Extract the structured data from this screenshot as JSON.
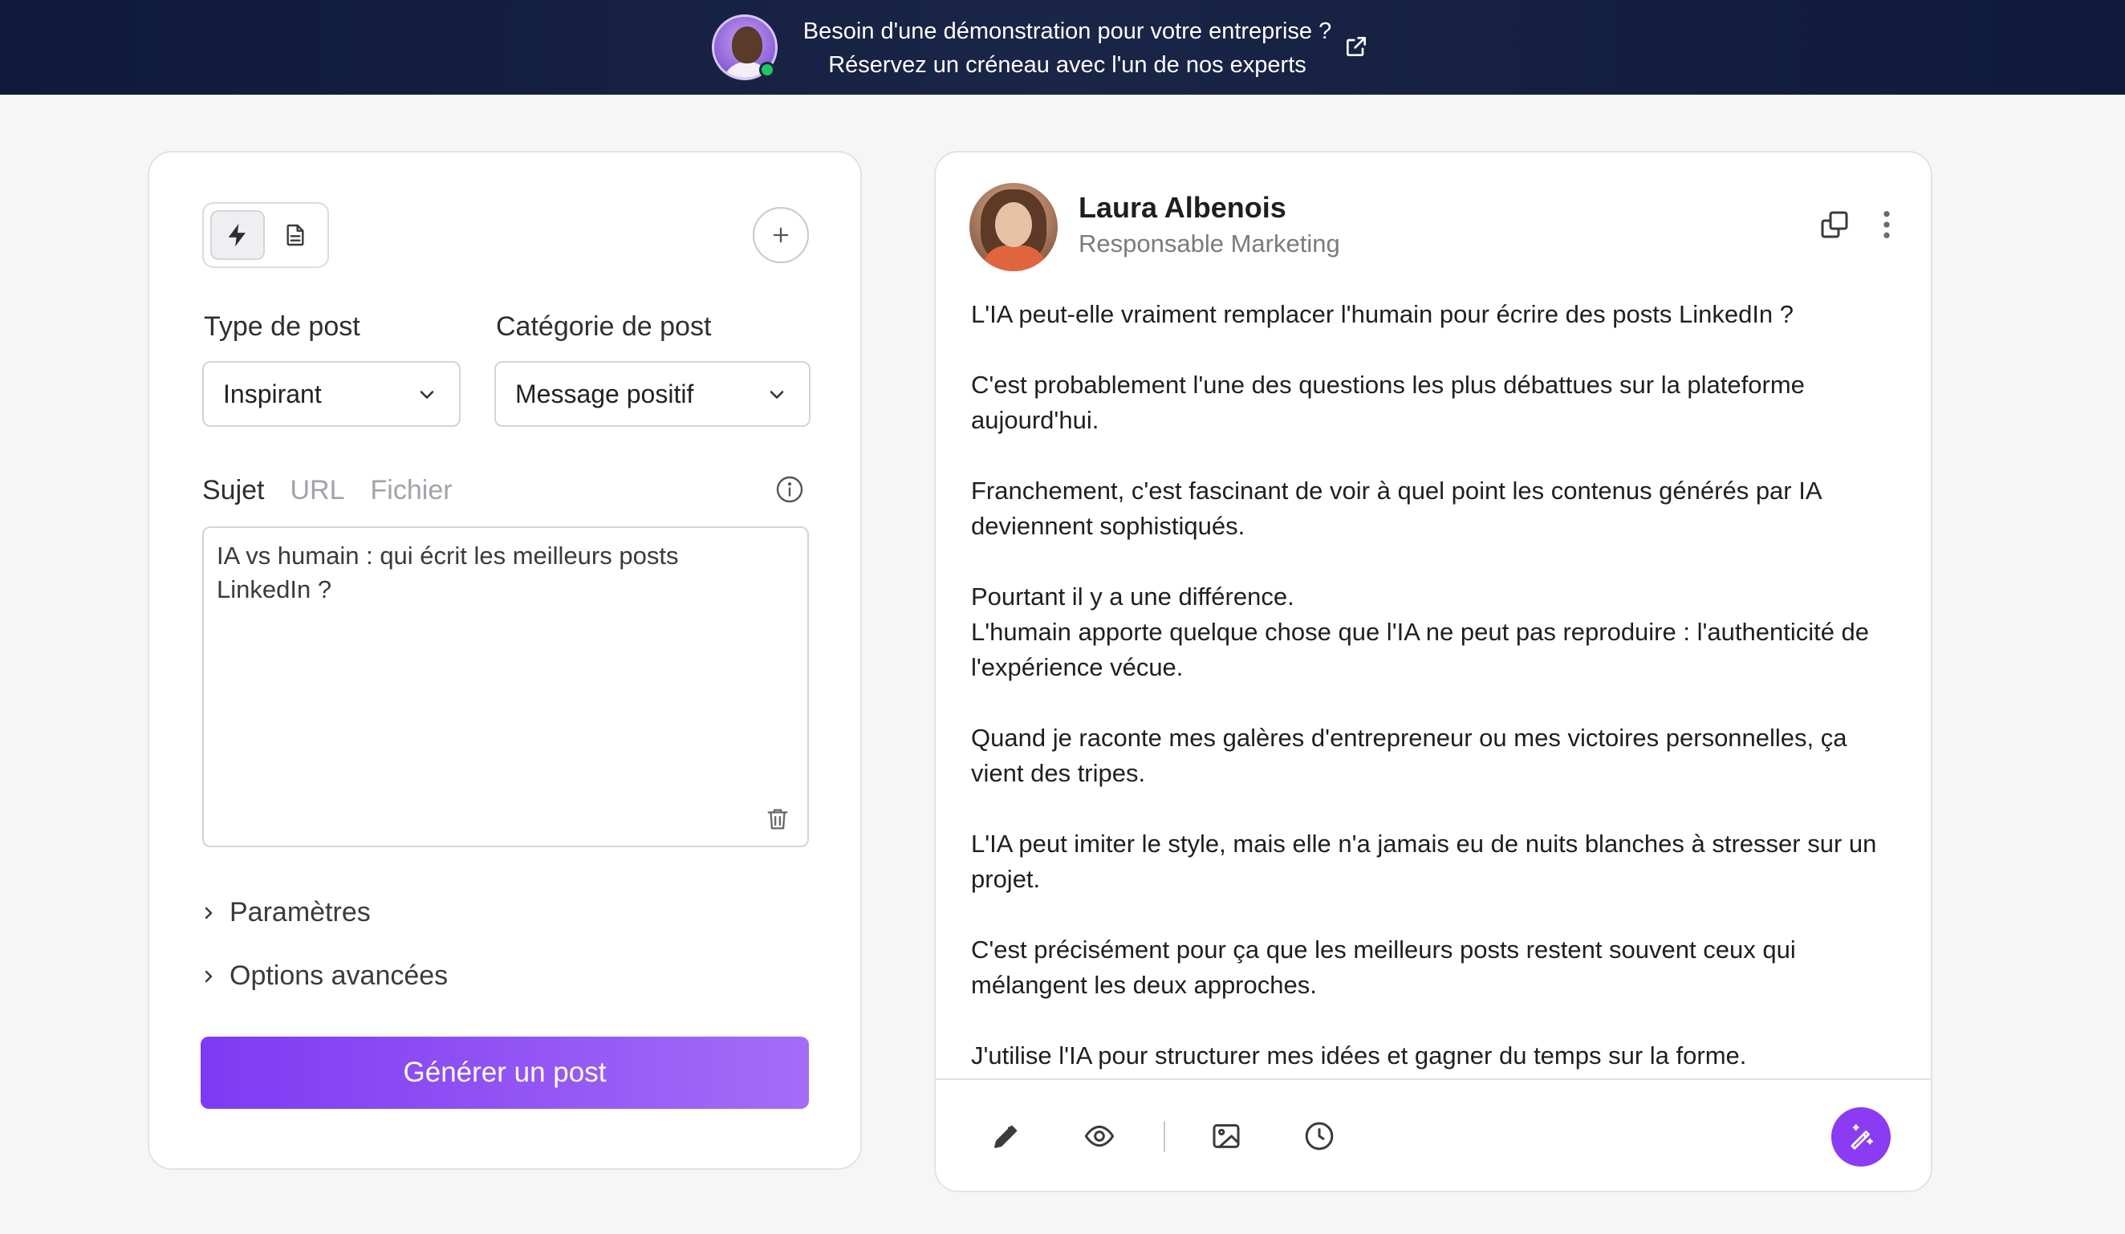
{
  "banner": {
    "line1": "Besoin d'une démonstration pour votre entreprise ?",
    "line2": "Réservez un créneau avec l'un de nos experts",
    "icon": "external-link-icon"
  },
  "left_panel": {
    "mode_icons": [
      "lightning-icon",
      "document-icon"
    ],
    "add_icon": "plus-icon",
    "post_type_label": "Type de post",
    "post_type_value": "Inspirant",
    "post_category_label": "Catégorie de post",
    "post_category_value": "Message positif",
    "tabs": [
      "Sujet",
      "URL",
      "Fichier"
    ],
    "active_tab": "Sujet",
    "subject_text": "IA vs humain : qui écrit les meilleurs posts LinkedIn ?",
    "parametres_label": "Paramètres",
    "options_label": "Options avancées",
    "generate_label": "Générer un post",
    "colors": {
      "accent": "#7e3af2",
      "accent_light": "#a46cf7"
    }
  },
  "post": {
    "author_name": "Laura Albenois",
    "author_role": "Responsable Marketing",
    "paragraphs": [
      "L'IA peut-elle vraiment remplacer l'humain pour écrire des posts LinkedIn ?",
      "C'est probablement l'une des questions les plus débattues sur la plateforme aujourd'hui.",
      "Franchement, c'est fascinant de voir à quel point les contenus générés par IA deviennent sophistiqués.",
      "Pourtant il y a une différence.",
      "L'humain apporte quelque chose que l'IA ne peut pas reproduire : l'authenticité de l'expérience vécue.",
      "Quand je raconte mes galères d'entrepreneur ou mes victoires personnelles, ça vient des tripes.",
      "L'IA peut imiter le style, mais elle n'a jamais eu de nuits blanches à stresser sur un projet.",
      "C'est précisément pour ça que les meilleurs posts restent souvent ceux qui mélangent les deux approches.",
      "J'utilise l'IA pour structurer mes idées et gagner du temps sur la forme."
    ],
    "toolbar_icons": [
      "pencil-icon",
      "eye-icon",
      "image-icon",
      "clock-icon",
      "magic-wand-icon"
    ],
    "header_icons": [
      "copy-icon",
      "more-vertical-icon"
    ]
  }
}
